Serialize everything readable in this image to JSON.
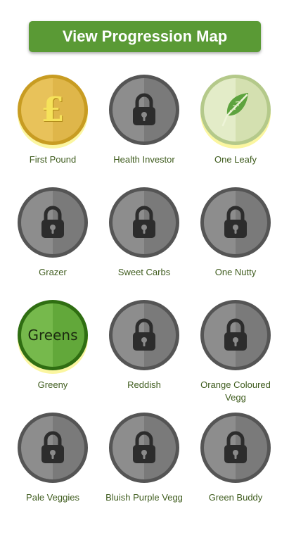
{
  "header": {
    "map_button_label": "View Progression Map"
  },
  "badges": [
    {
      "label": "First Pound",
      "state": "unlocked",
      "icon": "pound-icon",
      "glyph": "£"
    },
    {
      "label": "Health Investor",
      "state": "locked",
      "icon": "lock-icon"
    },
    {
      "label": "One Leafy",
      "state": "unlocked",
      "icon": "leaf-icon"
    },
    {
      "label": "Grazer",
      "state": "locked",
      "icon": "lock-icon"
    },
    {
      "label": "Sweet Carbs",
      "state": "locked",
      "icon": "lock-icon"
    },
    {
      "label": "One Nutty",
      "state": "locked",
      "icon": "lock-icon"
    },
    {
      "label": "Greeny",
      "state": "unlocked",
      "icon": "greens-icon",
      "glyph": "Greens"
    },
    {
      "label": "Reddish",
      "state": "locked",
      "icon": "lock-icon"
    },
    {
      "label": "Orange Coloured Vegg",
      "state": "locked",
      "icon": "lock-icon"
    },
    {
      "label": "Pale Veggies",
      "state": "locked",
      "icon": "lock-icon"
    },
    {
      "label": "Bluish Purple Vegg",
      "state": "locked",
      "icon": "lock-icon"
    },
    {
      "label": "Green Buddy",
      "state": "locked",
      "icon": "lock-icon"
    }
  ],
  "colors": {
    "button_green": "#5a9a35",
    "label_green": "#3f5c1e",
    "locked_grey": "#7a7a7a",
    "gold": "#e8c25a",
    "glow": "#fbf6a0"
  }
}
